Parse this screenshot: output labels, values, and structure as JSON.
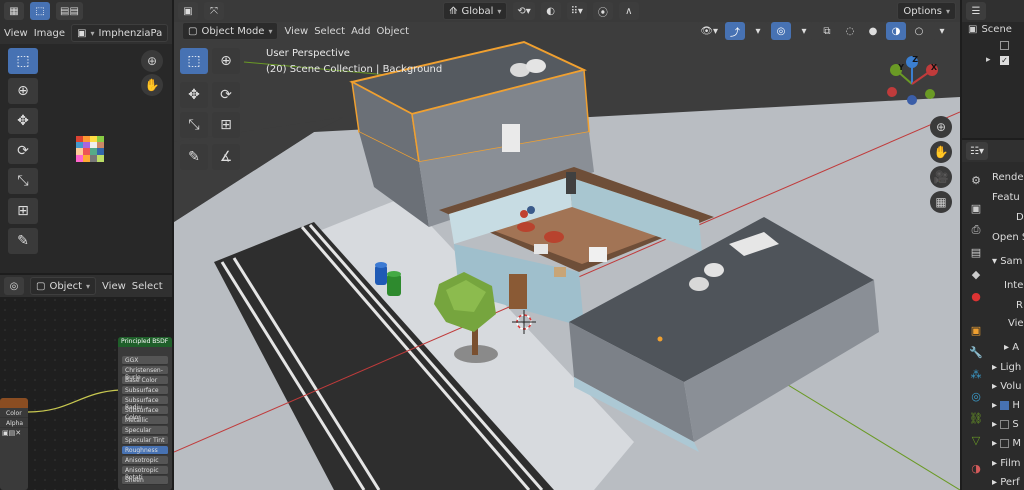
{
  "image_editor": {
    "menu": [
      "View",
      "Image"
    ],
    "image_name": "ImphenziaPa"
  },
  "node_editor": {
    "object_mode": "Object",
    "menu": [
      "View",
      "Select"
    ],
    "node_title": "Principled BSDF",
    "rows": [
      "GGX",
      "Christensen-Burle",
      "Base Color",
      "Subsurface",
      "Subsurface Radiu",
      "Subsurface Color",
      "Metallic",
      "Specular",
      "Specular Tint",
      "Roughness",
      "Anisotropic",
      "Anisotropic Rotati",
      "Sheen"
    ],
    "tex_outputs": [
      "Color",
      "Alpha"
    ]
  },
  "viewport": {
    "transform_orientation": "Global",
    "mode": "Object Mode",
    "menu": [
      "View",
      "Select",
      "Add",
      "Object"
    ],
    "options_label": "Options",
    "perspective_label": "User Perspective",
    "collection_label": "(20) Scene Collection | Background",
    "gizmo": {
      "x": "X",
      "y": "Y",
      "z": "Z"
    }
  },
  "outliner": {
    "scene_label": "Scene"
  },
  "properties": {
    "rows": [
      "Render",
      "Featu",
      "D",
      "Open S",
      "Sam",
      "Integ",
      "R",
      "View",
      "A",
      "Ligh",
      "Volu",
      "H",
      "S",
      "M",
      "Film",
      "Perf"
    ]
  },
  "colors": {
    "accent": "#4772b3",
    "selection_outline": "#f0a030",
    "x_axis": "#c03b3b",
    "y_axis": "#6a9a25"
  }
}
